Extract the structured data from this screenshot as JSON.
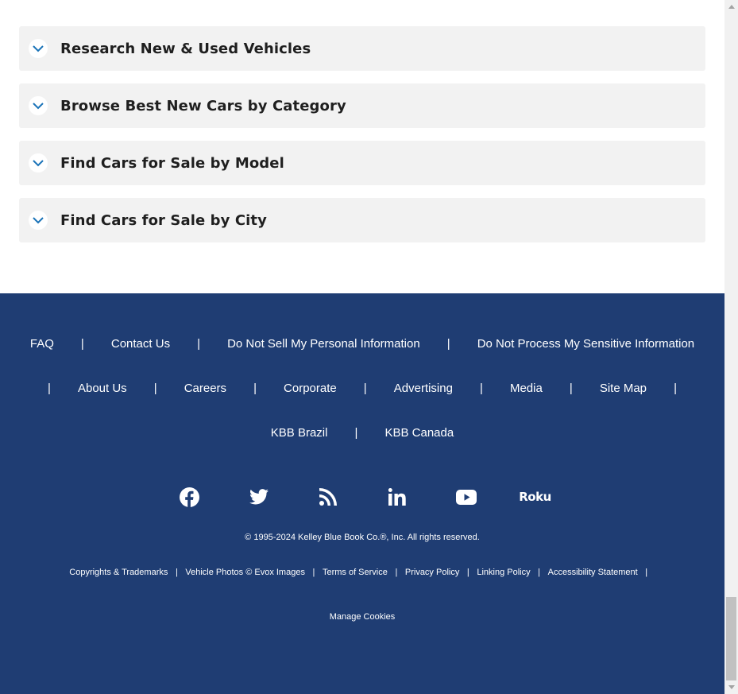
{
  "accordion": {
    "items": [
      {
        "label": "Research New & Used Vehicles"
      },
      {
        "label": "Browse Best New Cars by Category"
      },
      {
        "label": "Find Cars for Sale by Model"
      },
      {
        "label": "Find Cars for Sale by City"
      }
    ]
  },
  "footer": {
    "row1": [
      "FAQ",
      "Contact Us",
      "Do Not Sell My Personal Information",
      "Do Not Process My Sensitive Information"
    ],
    "row2": [
      "About Us",
      "Careers",
      "Corporate",
      "Advertising",
      "Media",
      "Site Map"
    ],
    "row3": [
      "KBB Brazil",
      "KBB Canada"
    ],
    "separator": "|",
    "social": [
      "facebook-icon",
      "twitter-icon",
      "rss-icon",
      "linkedin-icon",
      "youtube-icon",
      "roku-icon"
    ],
    "roku_text": "Roku",
    "copyright": "© 1995-2024 Kelley Blue Book Co.®, Inc. All rights reserved.",
    "legal": [
      "Copyrights & Trademarks",
      "Vehicle Photos © Evox Images",
      "Terms of Service",
      "Privacy Policy",
      "Linking Policy",
      "Accessibility Statement"
    ],
    "manage_cookies": "Manage Cookies"
  },
  "colors": {
    "footer_bg": "#1f3d73",
    "accordion_bg": "#f2f2f2",
    "chevron": "#1a73b8"
  }
}
